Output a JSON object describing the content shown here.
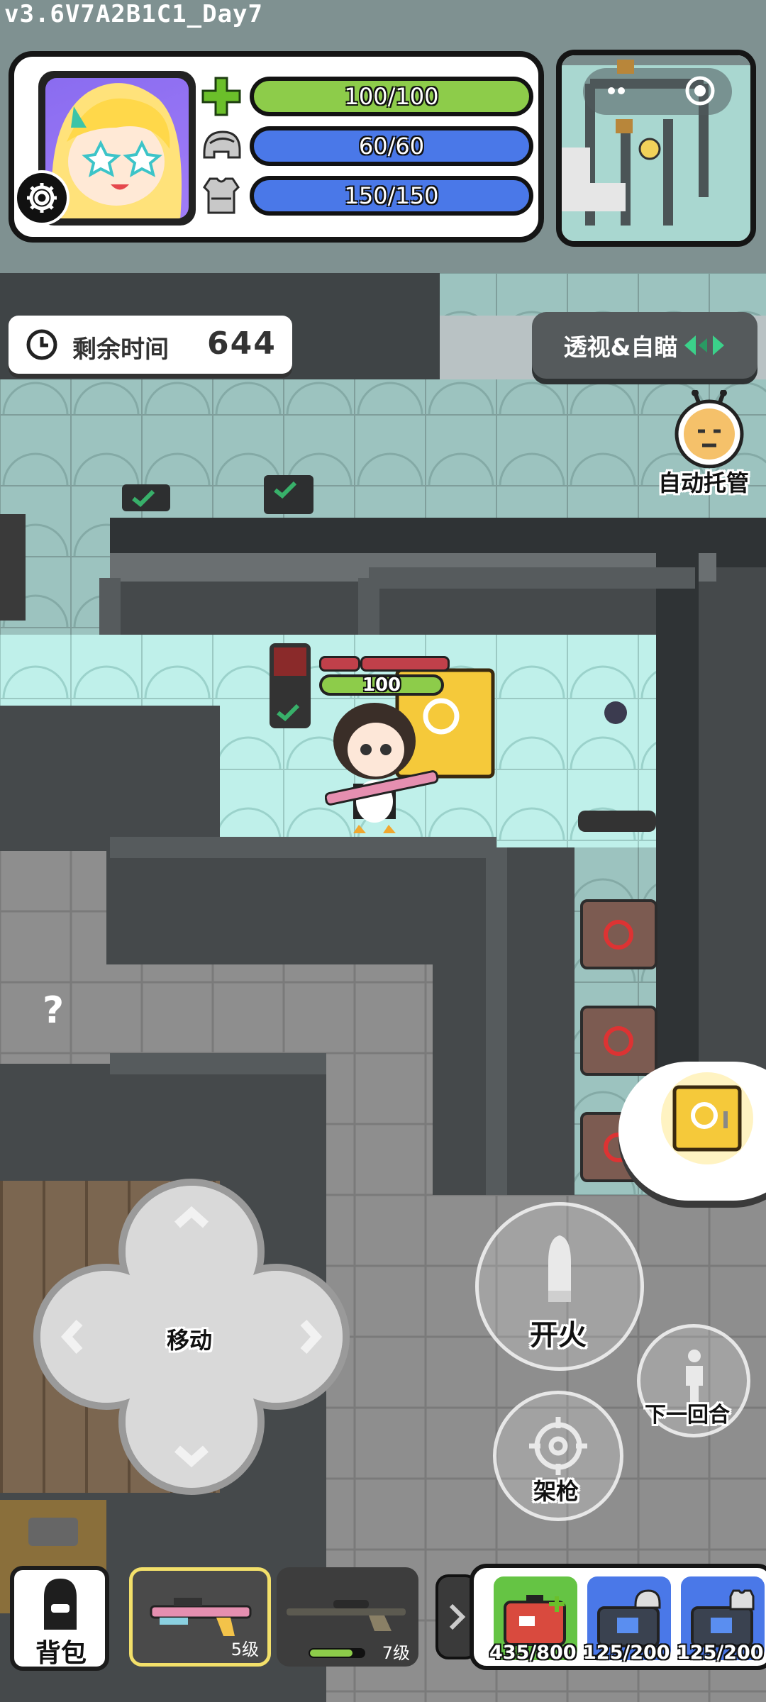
{
  "version": "v3.6V7A2B1C1_Day7",
  "colors": {
    "health": "#8dcc4a",
    "helmet": "#4a78e8",
    "armor": "#4a78e8",
    "hud_bg": "#7f9191",
    "gold": "#f5c93a",
    "weapon_selected_border": "#f3e06a"
  },
  "player_status": {
    "health": {
      "label": "100/100",
      "fill": 1.0,
      "icon": "health-cross-icon"
    },
    "helmet": {
      "label": "60/60",
      "fill": 1.0,
      "icon": "helmet-icon"
    },
    "armor": {
      "label": "150/150",
      "fill": 1.0,
      "icon": "armor-vest-icon"
    }
  },
  "timer": {
    "label": "剩余时间",
    "value": "644",
    "icon": "clock-icon"
  },
  "xray_button": {
    "label": "透视&自瞄",
    "icon": "arrows-icon"
  },
  "auto_button": {
    "label": "自动托管",
    "icon": "robot-face-icon"
  },
  "player": {
    "hp": "100"
  },
  "unknown_tile": "?",
  "controls": {
    "dpad_label": "移动",
    "fire_label": "开火",
    "aim_label": "架枪",
    "next_turn_label": "下一回合"
  },
  "bottom_bar": {
    "backpack_label": "背包",
    "weapons": [
      {
        "level": "5级",
        "selected": true,
        "icon": "rifle-pink-icon"
      },
      {
        "level": "7级",
        "selected": false,
        "icon": "sniper-rifle-icon"
      }
    ],
    "expand_icon": "chevron-right-icon",
    "items": [
      {
        "count": "435/800",
        "icon": "medkit-icon"
      },
      {
        "count": "125/200",
        "icon": "helmet-repair-bag-icon"
      },
      {
        "count": "125/200",
        "icon": "armor-repair-bag-icon"
      }
    ]
  }
}
